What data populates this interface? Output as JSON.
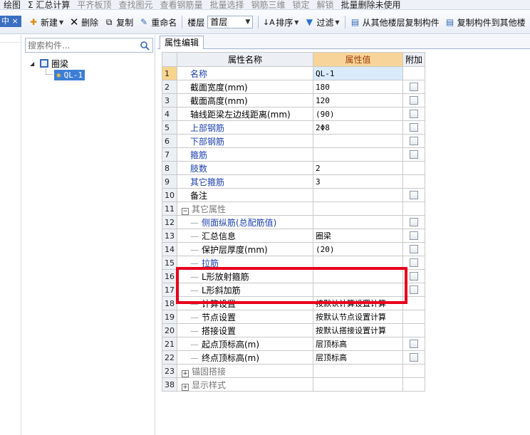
{
  "menubar": {
    "items": [
      {
        "label": "绘图",
        "dim": false
      },
      {
        "label": "Σ 汇总计算",
        "dim": false
      },
      {
        "label": "平齐板顶",
        "dim": true
      },
      {
        "label": "查找图元",
        "dim": true
      },
      {
        "label": "查看钢筋量",
        "dim": true
      },
      {
        "label": "批量选择",
        "dim": true
      },
      {
        "label": "钢筋三维",
        "dim": true
      },
      {
        "label": "锁定",
        "dim": true
      },
      {
        "label": "解锁",
        "dim": true
      },
      {
        "label": "批量删除未使用",
        "dim": false
      }
    ]
  },
  "left_tab": {
    "label": "中 ×"
  },
  "toolbar": {
    "new_label": "新建",
    "delete_label": "删除",
    "copy_label": "复制",
    "rename_label": "重命名",
    "floor_label": "楼层",
    "floor_value": "首层",
    "sort_label": "排序",
    "filter_label": "过滤",
    "copy_from_floor_label": "从其他楼层复制构件",
    "copy_to_floor_label": "复制构件到其他楼"
  },
  "tree": {
    "search_placeholder": "搜索构件...",
    "root_label": "圈梁",
    "child_label": "QL-1"
  },
  "props": {
    "tab_label": "属性编辑",
    "header": {
      "num": "",
      "name": "属性名称",
      "value": "属性值",
      "extra": "附加"
    },
    "rows": [
      {
        "num": "1",
        "name": "名称",
        "value": "QL-1",
        "style": "blue",
        "check": false,
        "selected": true,
        "indent": 0
      },
      {
        "num": "2",
        "name": "截面宽度(mm)",
        "value": "180",
        "style": "normal",
        "check": true,
        "indent": 0
      },
      {
        "num": "3",
        "name": "截面高度(mm)",
        "value": "120",
        "style": "normal",
        "check": true,
        "indent": 0
      },
      {
        "num": "4",
        "name": "轴线距梁左边线距离(mm)",
        "value": "(90)",
        "style": "normal",
        "check": true,
        "indent": 0
      },
      {
        "num": "5",
        "name": "上部钢筋",
        "value": "2Φ8",
        "style": "blue",
        "check": true,
        "indent": 0
      },
      {
        "num": "6",
        "name": "下部钢筋",
        "value": "",
        "style": "blue",
        "check": true,
        "indent": 0
      },
      {
        "num": "7",
        "name": "箍筋",
        "value": "",
        "style": "blue",
        "check": true,
        "indent": 0
      },
      {
        "num": "8",
        "name": "肢数",
        "value": "2",
        "style": "blue",
        "check": false,
        "indent": 0
      },
      {
        "num": "9",
        "name": "其它箍筋",
        "value": "3",
        "style": "blue",
        "check": false,
        "indent": 0
      },
      {
        "num": "10",
        "name": "备注",
        "value": "",
        "style": "normal",
        "check": true,
        "indent": 0
      },
      {
        "num": "11",
        "name": "其它属性",
        "value": "",
        "style": "group",
        "check": false,
        "indent": 0,
        "toggle": "−"
      },
      {
        "num": "12",
        "name": "侧面纵筋(总配筋值)",
        "value": "",
        "style": "blue",
        "check": true,
        "indent": 1
      },
      {
        "num": "13",
        "name": "汇总信息",
        "value": "圈梁",
        "style": "normal",
        "check": true,
        "indent": 1
      },
      {
        "num": "14",
        "name": "保护层厚度(mm)",
        "value": "(20)",
        "style": "normal",
        "check": true,
        "indent": 1
      },
      {
        "num": "15",
        "name": "拉筋",
        "value": "",
        "style": "blue",
        "check": true,
        "indent": 1
      },
      {
        "num": "16",
        "name": "L形放射箍筋",
        "value": "",
        "style": "normal",
        "check": true,
        "indent": 1
      },
      {
        "num": "17",
        "name": "L形斜加筋",
        "value": "",
        "style": "normal",
        "check": true,
        "indent": 1
      },
      {
        "num": "18",
        "name": "计算设置",
        "value": "按默认计算设置计算",
        "style": "normal",
        "check": false,
        "indent": 1
      },
      {
        "num": "19",
        "name": "节点设置",
        "value": "按默认节点设置计算",
        "style": "normal",
        "check": false,
        "indent": 1
      },
      {
        "num": "20",
        "name": "搭接设置",
        "value": "按默认搭接设置计算",
        "style": "normal",
        "check": false,
        "indent": 1
      },
      {
        "num": "21",
        "name": "起点顶标高(m)",
        "value": "层顶标高",
        "style": "normal",
        "check": true,
        "indent": 1
      },
      {
        "num": "22",
        "name": "终点顶标高(m)",
        "value": "层顶标高",
        "style": "normal",
        "check": true,
        "indent": 1
      },
      {
        "num": "23",
        "name": "锚固搭接",
        "value": "",
        "style": "group",
        "check": false,
        "indent": 0,
        "toggle": "+"
      },
      {
        "num": "38",
        "name": "显示样式",
        "value": "",
        "style": "group",
        "check": false,
        "indent": 0,
        "toggle": "+"
      }
    ]
  },
  "colors": {
    "highlight": "#e8001c",
    "header_value_bg": "#f7d49a",
    "selected_row": "#d9ebfb",
    "tree_selected": "#3d7ed6"
  }
}
